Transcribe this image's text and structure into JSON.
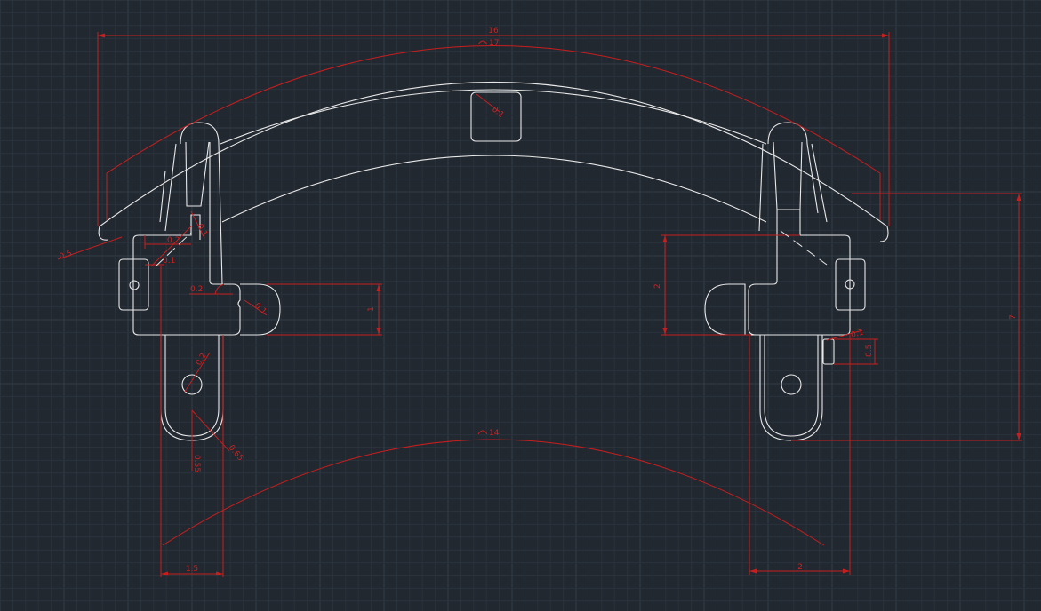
{
  "drawing": {
    "dimensions": {
      "overall_width": "16",
      "top_arc_radius": "17",
      "bottom_arc_radius": "14",
      "square_radius": "0.1",
      "left_outer_offset": "0.5",
      "left_step_horizontal": "0.2",
      "left_step_vertical": "0.1",
      "left_fillet": "0.1",
      "left_tab_gap": "0.2",
      "left_tab_fillet": "0.1",
      "left_tab_height": "1",
      "left_hole_radius": "0.2",
      "left_arm_radius_a": "0.55",
      "left_arm_radius_b": "0.65",
      "left_arm_width": "1.5",
      "left_diag_small": "0.1",
      "right_block_height": "2",
      "right_total_height": "7",
      "right_notch_radius": "0.1",
      "right_notch_height": "0.5",
      "right_arm_width": "2"
    },
    "colors": {
      "background": "#212830",
      "geometry": "#e8e8e8",
      "dimension": "#c81e1e"
    }
  }
}
